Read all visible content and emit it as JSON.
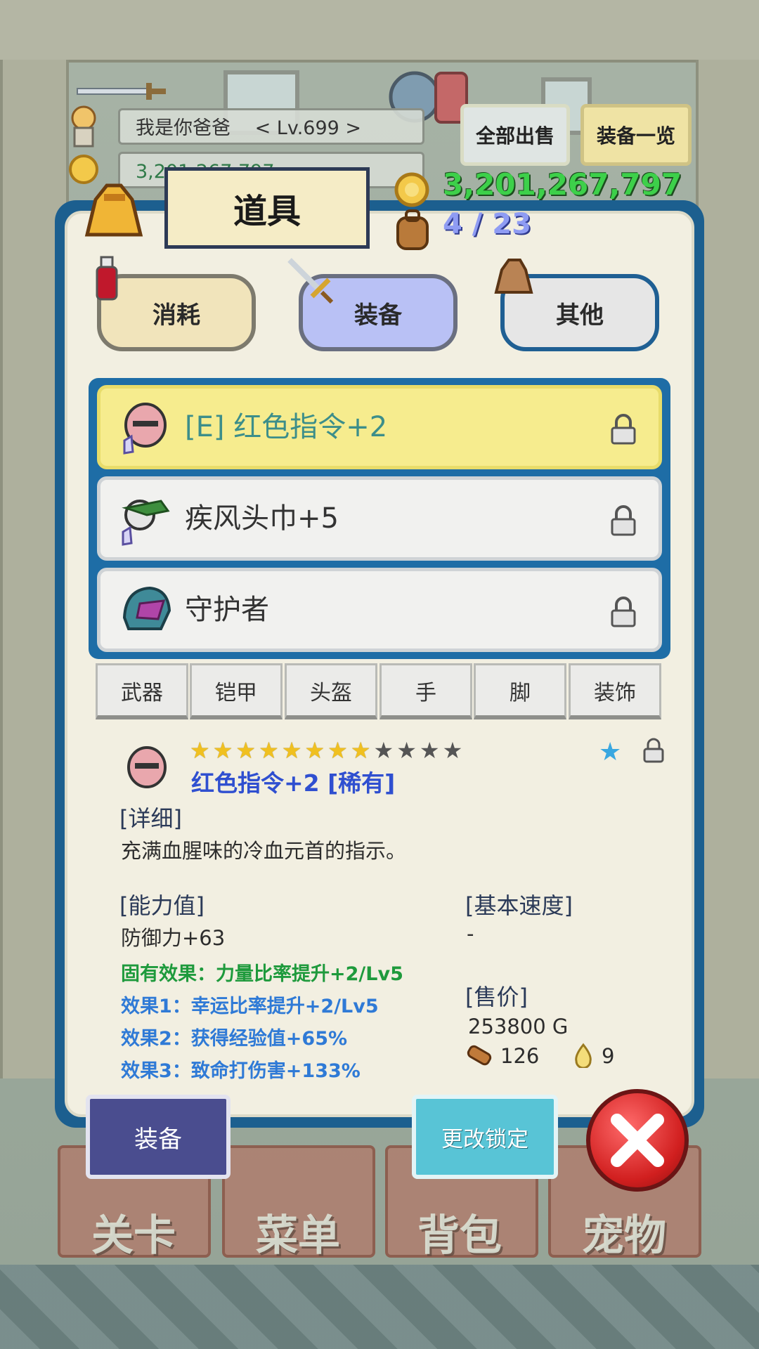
{
  "hud": {
    "player_name": "我是你爸爸",
    "player_level": "< Lv.699 >",
    "gold_small": "3,201,267,797",
    "sell_all_label": "全部出售",
    "equip_list_label": "装备一览"
  },
  "panel": {
    "title": "道具",
    "gold": "3,201,267,797",
    "bag_count": "4 / 23"
  },
  "category_tabs": [
    {
      "label": "消耗",
      "active": false
    },
    {
      "label": "装备",
      "active": true
    },
    {
      "label": "其他",
      "active": false
    }
  ],
  "items": [
    {
      "name": "[E] 红色指令+2",
      "selected": true,
      "icon": "red-mask-icon"
    },
    {
      "name": "疾风头巾+5",
      "selected": false,
      "icon": "green-bandana-icon"
    },
    {
      "name": "守护者",
      "selected": false,
      "icon": "guardian-helmet-icon"
    }
  ],
  "filter_tabs": [
    "武器",
    "铠甲",
    "头盔",
    "手",
    "脚",
    "装饰"
  ],
  "detail": {
    "stars_total": 12,
    "stars_filled": 8,
    "title": "红色指令+2 [稀有]",
    "detail_label": "[详细]",
    "description": "充满血腥味的冷血元首的指示。",
    "ability_label": "[能力值]",
    "defense": "防御力+63",
    "inherent": "固有效果：力量比率提升+2/Lv5",
    "effect1": "效果1：幸运比率提升+2/Lv5",
    "effect2": "效果2：获得经验值+65%",
    "effect3": "效果3：致命打伤害+133%",
    "speed_label": "[基本速度]",
    "speed_value": "-",
    "price_label": "[售价]",
    "price_value": "253800 G",
    "material_count": "126",
    "essence_count": "9"
  },
  "buttons": {
    "equip": "装备",
    "change_lock": "更改锁定"
  },
  "bottom_nav": [
    "关卡",
    "菜单",
    "背包",
    "宠物"
  ],
  "colors": {
    "panel_border": "#1c5f8f",
    "gold_text": "#3dd04a",
    "bag_text": "#8f9cf3",
    "selected_row": "#f6ec8e",
    "item_title": "#2f4fd0"
  }
}
